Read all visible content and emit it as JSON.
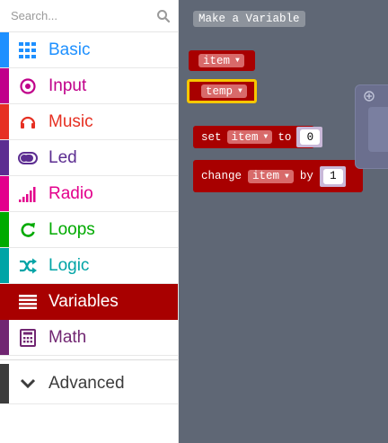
{
  "search": {
    "placeholder": "Search..."
  },
  "categories": [
    {
      "label": "Basic",
      "color": "#1e90ff",
      "icon": "grid-icon"
    },
    {
      "label": "Input",
      "color": "#c0008a",
      "icon": "target-icon"
    },
    {
      "label": "Music",
      "color": "#e63022",
      "icon": "headphones-icon"
    },
    {
      "label": "Led",
      "color": "#5c2d91",
      "icon": "toggle-icon"
    },
    {
      "label": "Radio",
      "color": "#e3008c",
      "icon": "signal-bars-icon"
    },
    {
      "label": "Loops",
      "color": "#00aa00",
      "icon": "loop-arrow-icon"
    },
    {
      "label": "Logic",
      "color": "#00a4a6",
      "icon": "shuffle-icon"
    },
    {
      "label": "Variables",
      "color": "#a80000",
      "icon": "list-lines-icon",
      "selected": true
    },
    {
      "label": "Math",
      "color": "#712672",
      "icon": "calculator-icon"
    }
  ],
  "advanced": {
    "label": "Advanced",
    "icon": "chevron-down-icon"
  },
  "workspace": {
    "make_variable_label": "Make a Variable",
    "blocks": {
      "var_item": "item",
      "var_temp": "temp",
      "set_keyword": "set",
      "set_var": "item",
      "set_to": "to",
      "set_value": "0",
      "change_keyword": "change",
      "change_var": "item",
      "change_by": "by",
      "change_value": "1"
    }
  }
}
